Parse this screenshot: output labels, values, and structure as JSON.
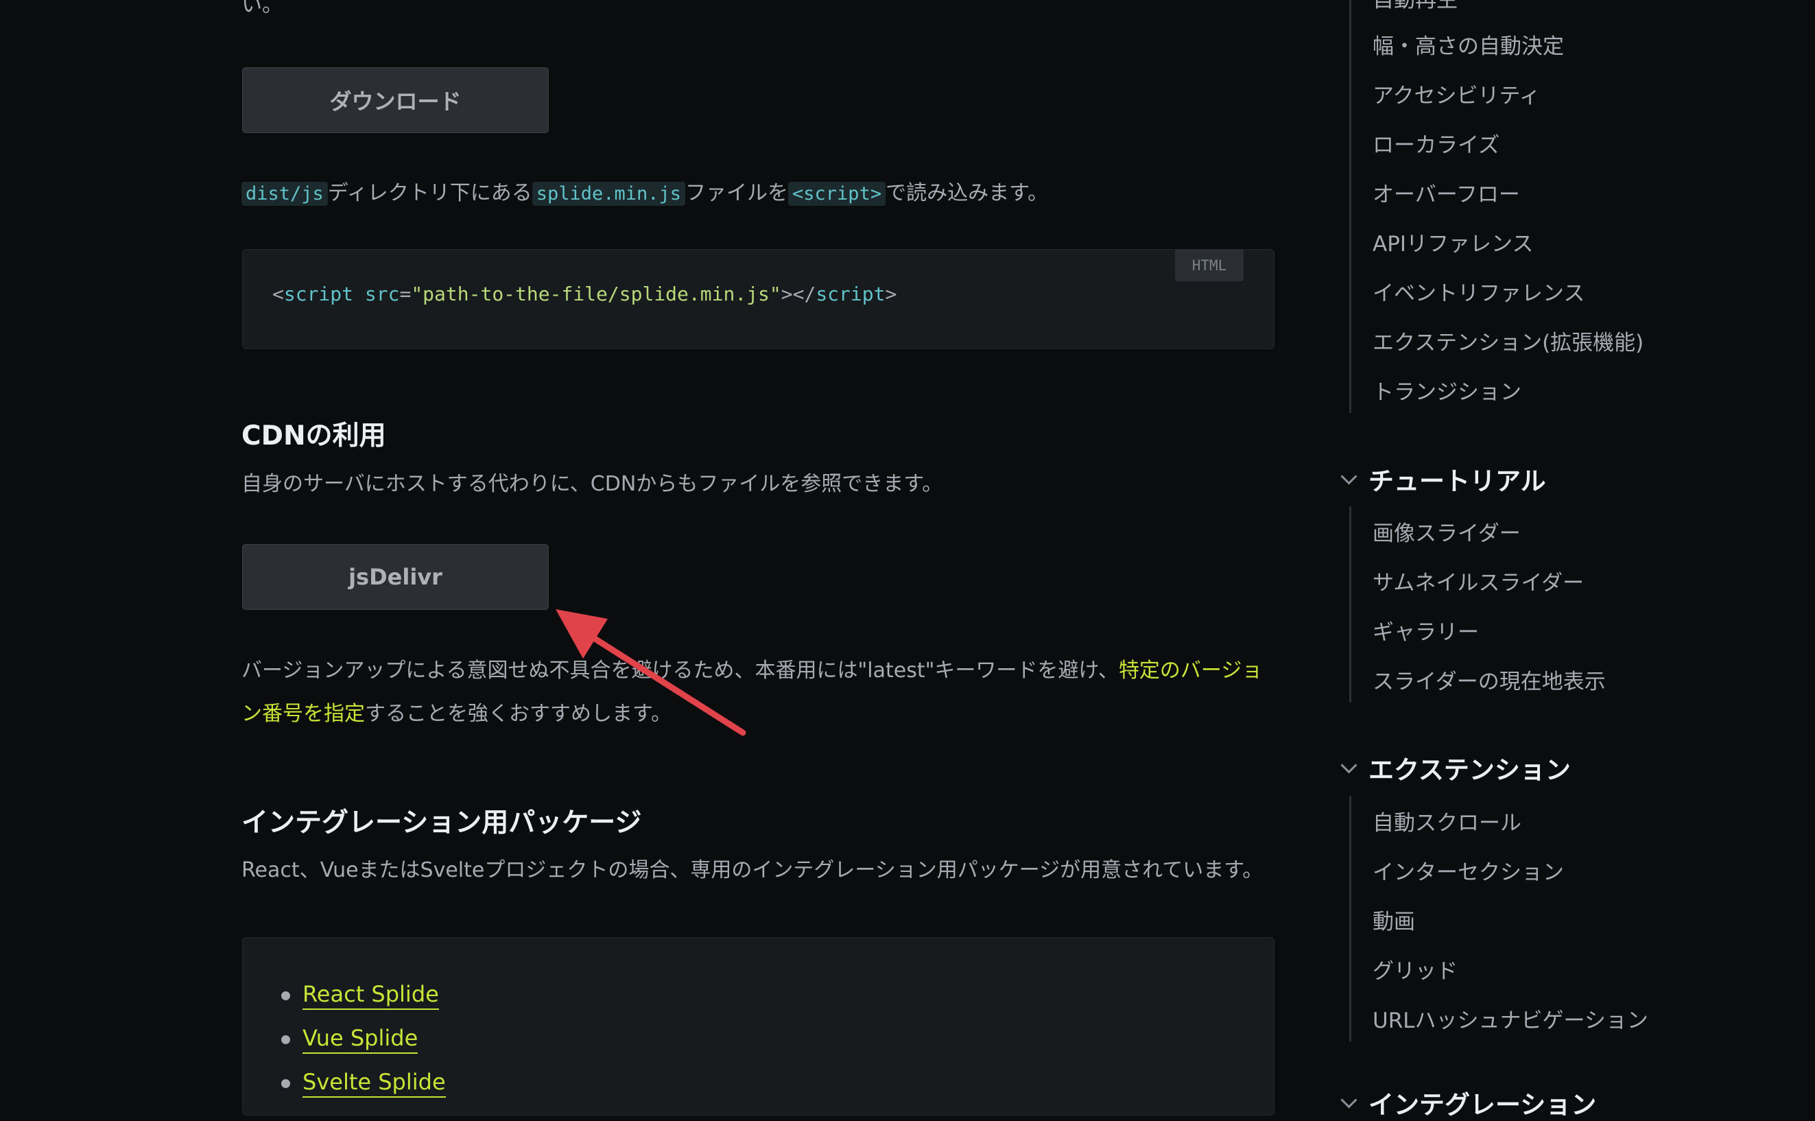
{
  "main": {
    "top_fragment": "い。",
    "download_button": "ダウンロード",
    "load_para": {
      "code1": "dist/js",
      "text1": "ディレクトリ下にある",
      "code2": "splide.min.js",
      "text2": "ファイルを",
      "code3": "<script>",
      "text3": "で読み込みます。"
    },
    "code_block": {
      "lang": "HTML",
      "lt": "<",
      "tag": "script",
      "attr": "src",
      "eq": "=",
      "value": "\"path-to-the-file/splide.min.js\"",
      "close": "></",
      "tag2": "script",
      "gt": ">"
    },
    "cdn": {
      "heading": "CDNの利用",
      "desc": "自身のサーバにホストする代わりに、CDNからもファイルを参照できます。",
      "button": "jsDelivr",
      "note_before": "バージョンアップによる意図せぬ不具合を避けるため、本番用には\"latest\"キーワードを避け、",
      "note_link": "特定のバージョン番号を指定",
      "note_after": "することを強くおすすめします。"
    },
    "integration": {
      "heading": "インテグレーション用パッケージ",
      "desc": "React、VueまたはSvelteプロジェクトの場合、専用のインテグレーション用パッケージが用意されています。",
      "packages": [
        "React Splide",
        "Vue Splide",
        "Svelte Splide"
      ]
    }
  },
  "sidebar": {
    "partial_top": "自動再生",
    "group1_items": [
      "幅・高さの自動決定",
      "アクセシビリティ",
      "ローカライズ",
      "オーバーフロー",
      "APIリファレンス",
      "イベントリファレンス",
      "エクステンション(拡張機能)",
      "トランジション"
    ],
    "tutorial_heading": "チュートリアル",
    "tutorial_items": [
      "画像スライダー",
      "サムネイルスライダー",
      "ギャラリー",
      "スライダーの現在地表示"
    ],
    "extension_heading": "エクステンション",
    "extension_items": [
      "自動スクロール",
      "インターセクション",
      "動画",
      "グリッド",
      "URLハッシュナビゲーション"
    ],
    "partial_bottom": "インテグレーション"
  },
  "colors": {
    "background": "#0b0c0e",
    "accent_link": "#c9e336",
    "annotation_arrow": "#e0434a"
  }
}
